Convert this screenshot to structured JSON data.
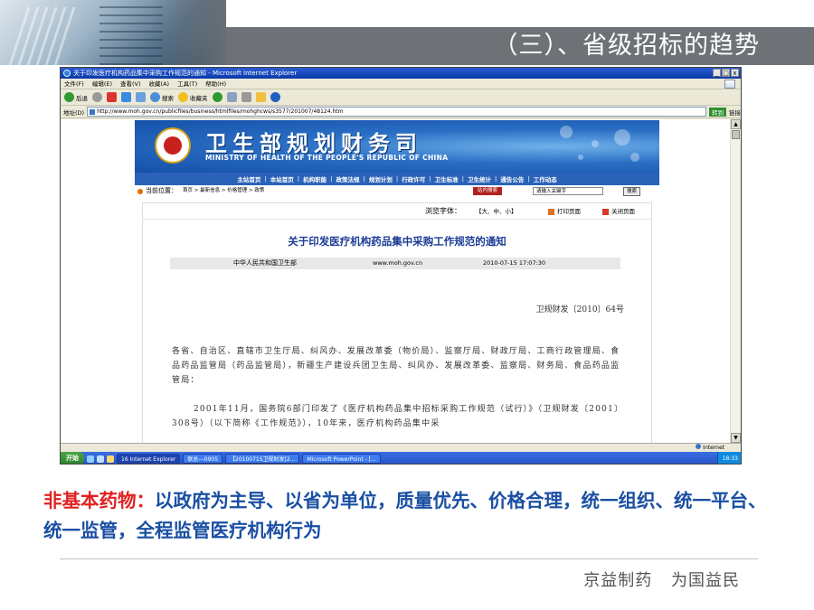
{
  "slide": {
    "title": "（三）、省级招标的趋势",
    "body_label": "非基本药物：",
    "body_text": "以政府为主导、以省为单位，质量优先、价格合理，统一组织、统一平台、统一监管，全程监管医疗机构行为",
    "footer": "京益制药    为国益民"
  },
  "browser": {
    "title": "关于印发医疗机构药品集中采购工作规范的通知 - Microsoft Internet Explorer",
    "window_controls": [
      "_",
      "□",
      "x"
    ],
    "menu": [
      "文件(F)",
      "编辑(E)",
      "查看(V)",
      "收藏(A)",
      "工具(T)",
      "帮助(H)"
    ],
    "toolbar": {
      "back": "后退",
      "search": "搜索",
      "favorites": "收藏夹"
    },
    "address_label": "地址(D)",
    "address": "http://www.moh.gov.cn/publicfiles/business/htmlfiles/mohghcws/s3577/201007/48124.htm",
    "go_label": "转到",
    "links_label": "链接",
    "status_zone": "Internet"
  },
  "taskbar": {
    "start": "开始",
    "tasks": [
      "16 Internet Explorer",
      "联总---0905",
      "【2010071S卫规财发[2...",
      "Microsoft PowerPoint - [..."
    ],
    "clock": "18:33"
  },
  "site": {
    "title": "卫生部规划财务司",
    "subtitle": "MINISTRY OF HEALTH OF THE PEOPLE'S REPUBLIC OF CHINA",
    "nav": [
      "主站首页",
      "本站首页",
      "机构职能",
      "政策法规",
      "规划计划",
      "行政许可",
      "卫生标准",
      "卫生统计",
      "通告公告",
      "工作动态"
    ],
    "crumb_label": "当前位置：",
    "crumb_path": "首页 > 最新信息 > 价格管理 > 政策",
    "search_btn": "站内搜索",
    "search_placeholder": "请输入关键字",
    "search_go": "搜索"
  },
  "article": {
    "font_label": "浏览字体：",
    "font_sizes": "【大、中、小】",
    "print": "打印页面",
    "close": "关闭页面",
    "title": "关于印发医疗机构药品集中采购工作规范的通知",
    "publisher": "中华人民共和国卫生部",
    "website": "www.moh.gov.cn",
    "date": "2010-07-15  17:07:30",
    "doc_no": "卫规财发〔2010〕64号",
    "para1": "各省、自治区、直辖市卫生厅局、纠风办、发展改革委（物价局）、监察厅局、财政厅局、工商行政管理局、食品药品监管局（药品监管局），新疆生产建设兵团卫生局、纠风办、发展改革委、监察局、财务局、食品药品监管局：",
    "para2": "2001年11月，国务院6部门印发了《医疗机构药品集中招标采购工作规范（试行）》（卫规财发〔2001〕308号）（以下简称《工作规范》），10年来，医疗机构药品集中采"
  }
}
